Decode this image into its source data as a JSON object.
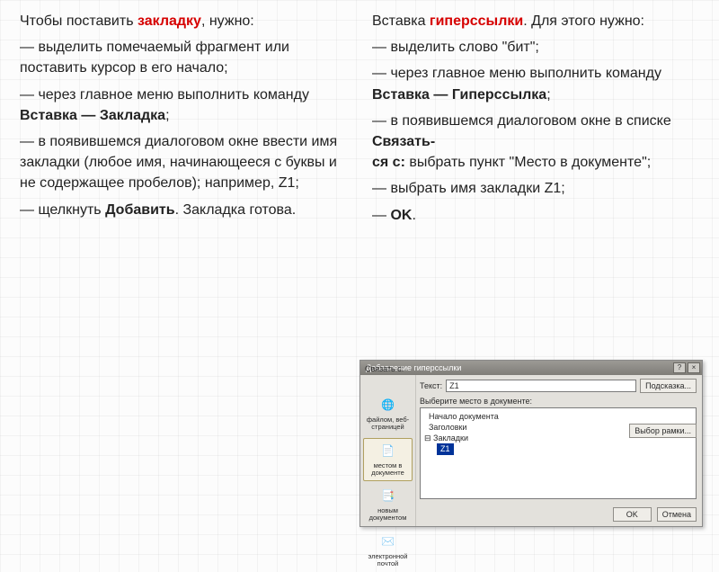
{
  "left": {
    "intro_pre": "Чтобы поставить ",
    "intro_hl": "закладку",
    "intro_post": ", нужно:",
    "b1": "— выделить помечаемый фрагмент или поставить курсор в его начало;",
    "b2_pre": "— через главное меню выполнить команду ",
    "b2_bold": "Вставка — Закладка",
    "b2_post": ";",
    "b3": "— в появившемся диалоговом окне ввести имя закладки (любое имя, начинающееся с буквы и не содержащее пробелов); например, Z1;",
    "b4_pre": "— щелкнуть ",
    "b4_bold": "Добавить",
    "b4_post": ". Закладка готова."
  },
  "right": {
    "intro_pre": "Вставка ",
    "intro_hl": "гиперссылки",
    "intro_post": ". Для этого нужно:",
    "b1": "— выделить слово \"бит\";",
    "b2_pre": "— через главное меню выполнить команду ",
    "b2_bold": "Вставка — Гиперссылка",
    "b2_post": ";",
    "b3_pre": "— в появившемся диалоговом окне в списке ",
    "b3_bold": "Связать-\nся с:",
    "b3_post": " выбрать пункт \"Место в документе\";",
    "b4": "— выбрать имя закладки Z1;",
    "b5_pre": "— ",
    "b5_bold": "OK",
    "b5_post": "."
  },
  "dialog": {
    "title": "Добавление гиперссылки",
    "help_btn": "?",
    "close_btn": "×",
    "link_with": "Связать с:",
    "text_label": "Текст:",
    "text_value": "Z1",
    "hint_btn": "Подсказка...",
    "side": {
      "file": "файлом, веб-\nстраницей",
      "place": "местом в\nдокументе",
      "newdoc": "новым\nдокументом",
      "email": "электронной\nпочтой"
    },
    "group_label": "Выберите место в документе:",
    "tree": {
      "n1": "  Начало документа",
      "n2": "  Заголовки",
      "n3": "⊟ Закладки",
      "leaf": "Z1"
    },
    "frame_btn": "Выбор рамки...",
    "ok": "OK",
    "cancel": "Отмена"
  }
}
